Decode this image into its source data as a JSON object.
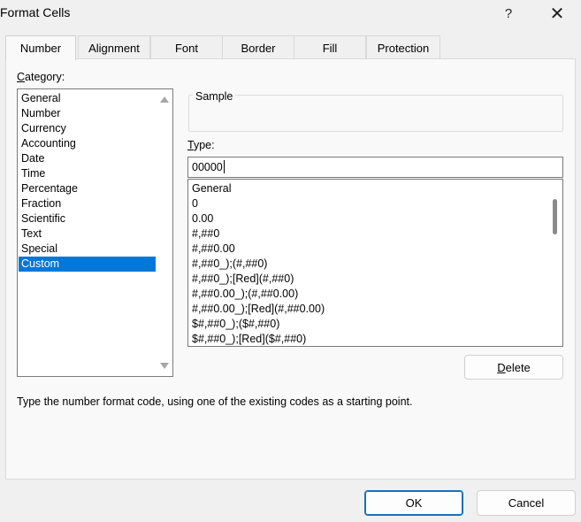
{
  "window": {
    "title": "Format Cells",
    "help_glyph": "?",
    "close_glyph": "✕"
  },
  "tabs": [
    {
      "label": "Number",
      "active": true
    },
    {
      "label": "Alignment",
      "active": false
    },
    {
      "label": "Font",
      "active": false
    },
    {
      "label": "Border",
      "active": false
    },
    {
      "label": "Fill",
      "active": false
    },
    {
      "label": "Protection",
      "active": false
    }
  ],
  "category": {
    "label_first": "C",
    "label_rest": "ategory:",
    "items": [
      "General",
      "Number",
      "Currency",
      "Accounting",
      "Date",
      "Time",
      "Percentage",
      "Fraction",
      "Scientific",
      "Text",
      "Special",
      "Custom"
    ],
    "selected": "Custom"
  },
  "sample": {
    "label": "Sample",
    "value": ""
  },
  "type": {
    "label_first": "T",
    "label_rest": "ype:",
    "value": "00000"
  },
  "formats": [
    "General",
    "0",
    "0.00",
    "#,##0",
    "#,##0.00",
    "#,##0_);(#,##0)",
    "#,##0_);[Red](#,##0)",
    "#,##0.00_);(#,##0.00)",
    "#,##0.00_);[Red](#,##0.00)",
    "$#,##0_);($#,##0)",
    "$#,##0_);[Red]($#,##0)"
  ],
  "buttons": {
    "delete_first": "D",
    "delete_rest": "elete",
    "ok": "OK",
    "cancel": "Cancel"
  },
  "description": "Type the number format code, using one of the existing codes as a starting point.",
  "colors": {
    "selection": "#0078d7",
    "dialog_bg": "#f0f0f0",
    "panel_bg": "#f9f9f9"
  }
}
